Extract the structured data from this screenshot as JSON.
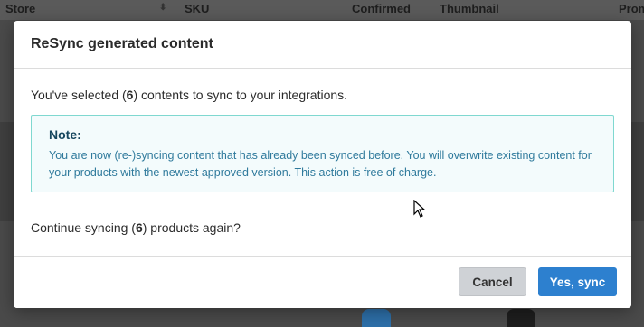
{
  "background_table": {
    "columns": [
      "Store",
      "SKU",
      "Confirmed",
      "Thumbnail",
      "Prom"
    ]
  },
  "modal": {
    "title": "ReSync generated content",
    "line1": {
      "prefix": "You've selected (",
      "count": "6",
      "suffix": ") contents to sync to your integrations."
    },
    "note": {
      "title": "Note:",
      "text": "You are now (re-)syncing content that has already been synced before. You will overwrite existing content for your products with the newest approved version. This action is free of charge."
    },
    "line2": {
      "prefix": "Continue syncing (",
      "count": "6",
      "suffix": ") products again?"
    },
    "buttons": {
      "cancel": "Cancel",
      "confirm": "Yes, sync"
    }
  },
  "colors": {
    "confirm_button": "#2d80cf",
    "note_border": "#7fd8d0",
    "note_text": "#2f7a9c"
  }
}
